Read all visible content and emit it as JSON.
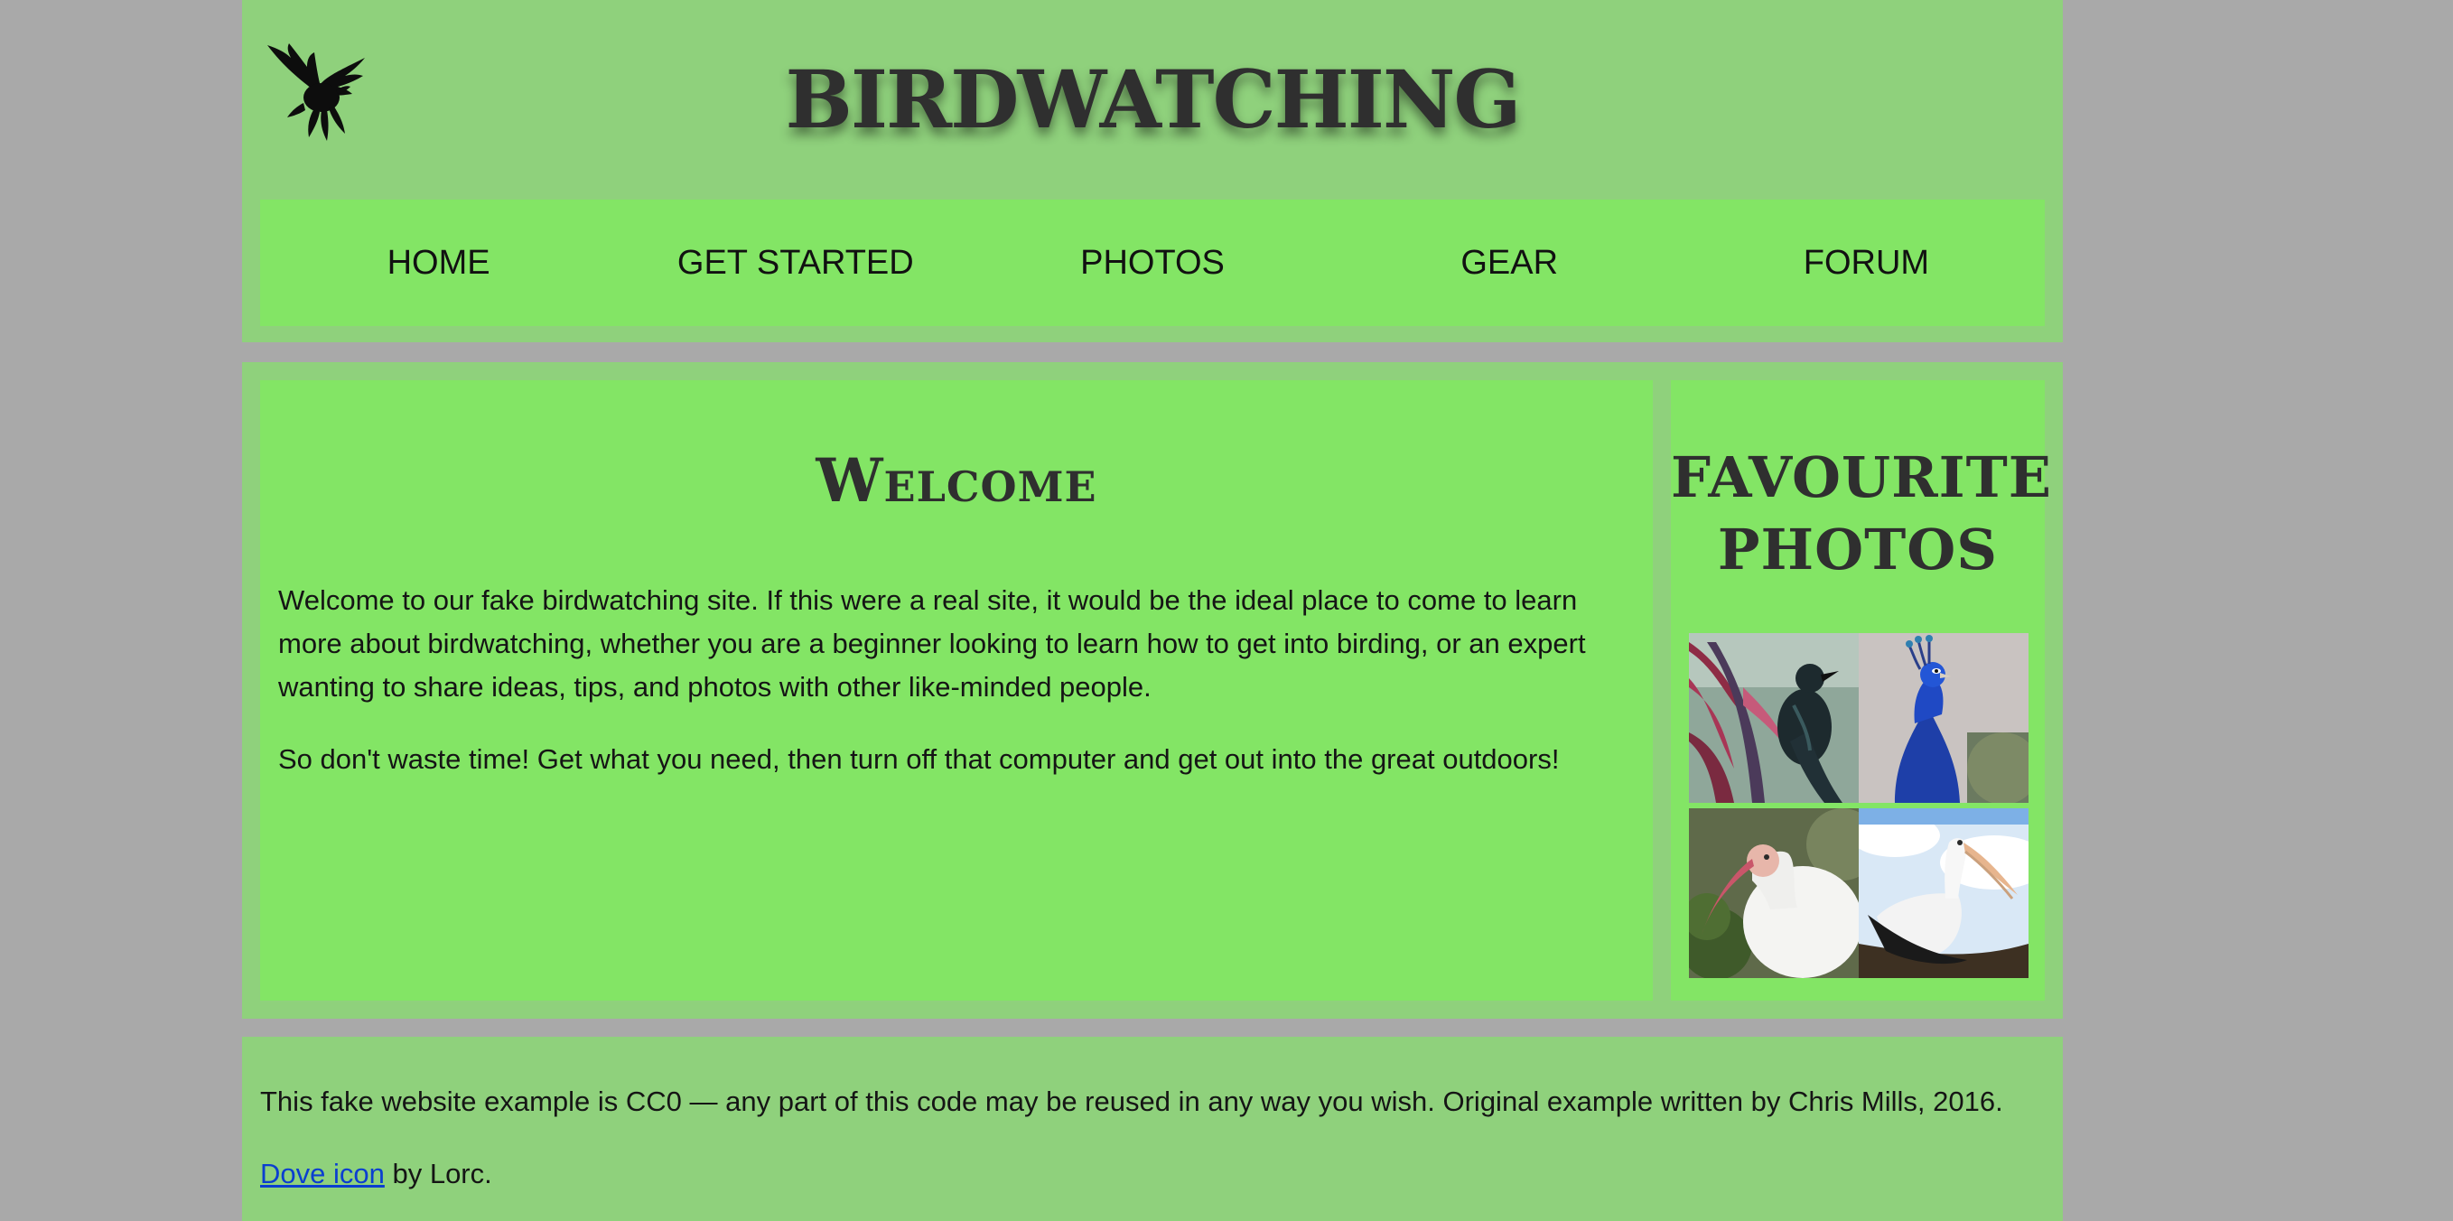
{
  "header": {
    "title": "BIRDWATCHING",
    "logo_icon": "dove-icon"
  },
  "nav": {
    "items": [
      {
        "label": "HOME"
      },
      {
        "label": "GET STARTED"
      },
      {
        "label": "PHOTOS"
      },
      {
        "label": "GEAR"
      },
      {
        "label": "FORUM"
      }
    ]
  },
  "welcome": {
    "heading": "Welcome",
    "paragraph1": "Welcome to our fake birdwatching site. If this were a real site, it would be the ideal place to come to learn more about birdwatching, whether you are a beginner looking to learn how to get into birding, or an expert wanting to share ideas, tips, and photos with other like-minded people.",
    "paragraph2": "So don't waste time! Get what you need, then turn off that computer and get out into the great outdoors!"
  },
  "favourites": {
    "heading": "FAVOURITE PHOTOS",
    "photos": [
      {
        "subject": "tui"
      },
      {
        "subject": "peacock"
      },
      {
        "subject": "white-ibis"
      },
      {
        "subject": "pelican"
      }
    ]
  },
  "footer": {
    "license_text": "This fake website example is CC0 — any part of this code may be reused in any way you wish. Original example written by Chris Mills, 2016.",
    "credit_link": "Dove icon",
    "credit_suffix": " by Lorc."
  },
  "colors": {
    "page_background": "#a9a9a9",
    "frame_green": "#8fd17c",
    "panel_green": "#83e565",
    "link_blue": "#0b3fd0"
  }
}
